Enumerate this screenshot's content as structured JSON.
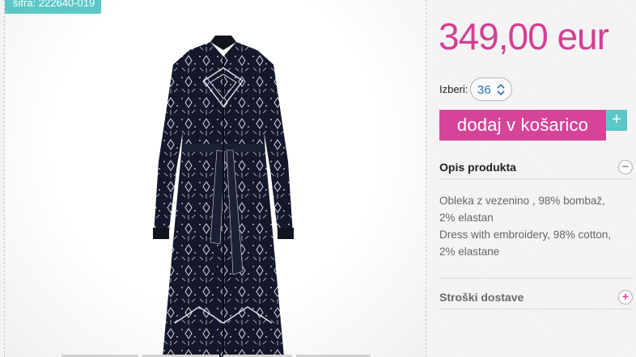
{
  "product": {
    "sku_label": "šifra: 222640-019",
    "image_alt": "dress",
    "thumbnail_count": 4
  },
  "purchase": {
    "price": "349,00 eur",
    "size_label": "Izberi:",
    "size_value": "36",
    "add_to_cart_label": "dodaj v košarico",
    "plus_label": "+"
  },
  "sections": {
    "description": {
      "title": "Opis produkta",
      "toggle": "−",
      "lines": [
        "Obleka z vezenino , 98% bombaž,",
        "2% elastan",
        "Dress with embroidery, 98% cotton,",
        "2% elastane"
      ]
    },
    "shipping": {
      "title": "Stroški dostave",
      "toggle": "+"
    }
  },
  "colors": {
    "accent_pink": "#d6449a",
    "accent_teal": "#5cc7c7",
    "price_pink": "#d43f94",
    "dress_navy": "#14182a"
  },
  "icons": {
    "size_select_arrows": "updown-chevron-icon",
    "expand": "plus-icon",
    "collapse": "minus-icon"
  }
}
